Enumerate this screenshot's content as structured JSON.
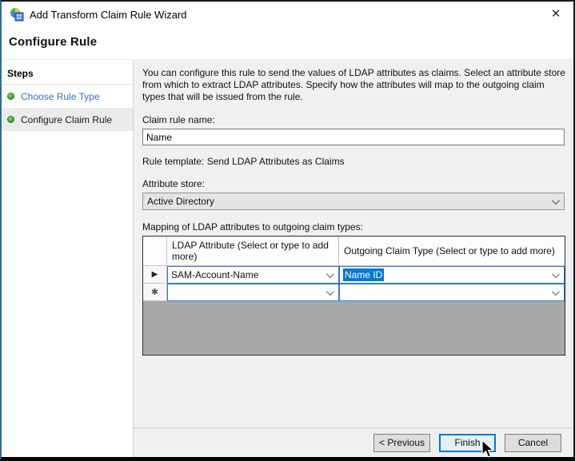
{
  "window": {
    "title": "Add Transform Claim Rule Wizard",
    "close_glyph": "✕"
  },
  "page": {
    "heading": "Configure Rule"
  },
  "steps": {
    "header": "Steps",
    "items": [
      {
        "label": "Choose Rule Type",
        "state": "completed-link"
      },
      {
        "label": "Configure Claim Rule",
        "state": "active"
      }
    ]
  },
  "main": {
    "description": "You can configure this rule to send the values of LDAP attributes as claims. Select an attribute store from which to extract LDAP attributes. Specify how the attributes will map to the outgoing claim types that will be issued from the rule.",
    "claim_rule_name": {
      "label": "Claim rule name:",
      "value": "Name"
    },
    "rule_template_line": "Rule template: Send LDAP Attributes as Claims",
    "attribute_store": {
      "label": "Attribute store:",
      "value": "Active Directory"
    },
    "mapping_label": "Mapping of LDAP attributes to outgoing claim types:",
    "mapping_table": {
      "columns": {
        "ldap": "LDAP Attribute (Select or type to add more)",
        "outgoing": "Outgoing Claim Type (Select or type to add more)"
      },
      "rows": [
        {
          "marker": "▶",
          "ldap_attribute": "SAM-Account-Name",
          "outgoing_claim_type": "Name ID",
          "outgoing_selected": true
        },
        {
          "marker": "✱",
          "ldap_attribute": "",
          "outgoing_claim_type": "",
          "outgoing_selected": false
        }
      ]
    }
  },
  "footer": {
    "previous_label": "< Previous",
    "finish_label": "Finish",
    "cancel_label": "Cancel"
  },
  "colors": {
    "accent_blue": "#0078d7",
    "selection_blue": "#0078d7",
    "step_link_blue": "#3b6bc4",
    "step_dot_green": "#3a9e2e",
    "panel_gray": "#f0f0f0",
    "grid_filler_gray": "#a8a8a8"
  }
}
